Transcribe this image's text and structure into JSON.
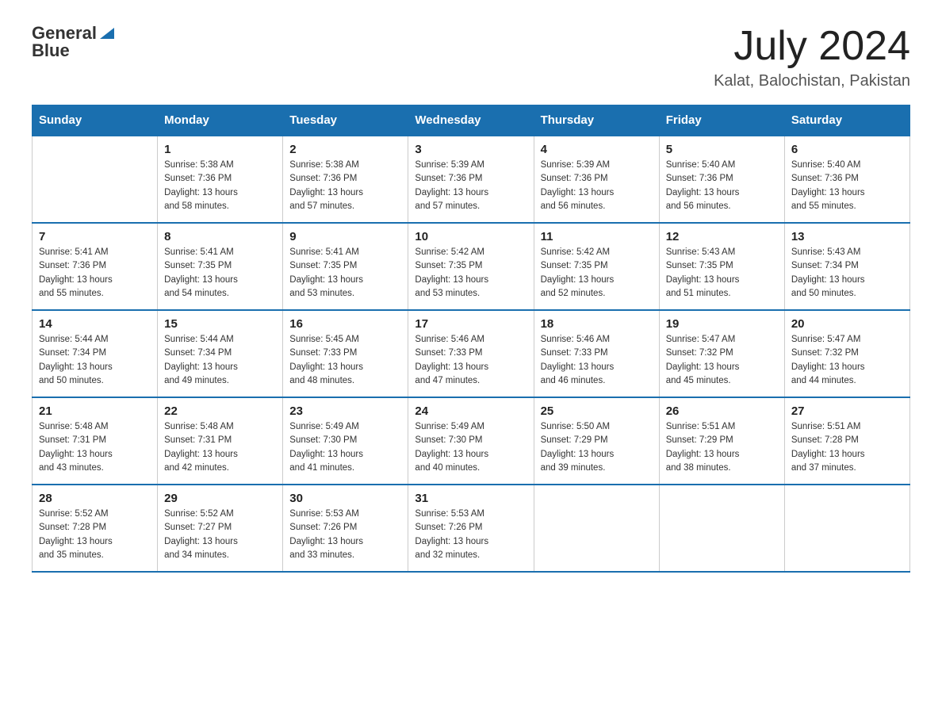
{
  "header": {
    "logo_general": "General",
    "logo_blue": "Blue",
    "month_title": "July 2024",
    "location": "Kalat, Balochistan, Pakistan"
  },
  "days_of_week": [
    "Sunday",
    "Monday",
    "Tuesday",
    "Wednesday",
    "Thursday",
    "Friday",
    "Saturday"
  ],
  "weeks": [
    [
      {
        "day": "",
        "info": ""
      },
      {
        "day": "1",
        "info": "Sunrise: 5:38 AM\nSunset: 7:36 PM\nDaylight: 13 hours\nand 58 minutes."
      },
      {
        "day": "2",
        "info": "Sunrise: 5:38 AM\nSunset: 7:36 PM\nDaylight: 13 hours\nand 57 minutes."
      },
      {
        "day": "3",
        "info": "Sunrise: 5:39 AM\nSunset: 7:36 PM\nDaylight: 13 hours\nand 57 minutes."
      },
      {
        "day": "4",
        "info": "Sunrise: 5:39 AM\nSunset: 7:36 PM\nDaylight: 13 hours\nand 56 minutes."
      },
      {
        "day": "5",
        "info": "Sunrise: 5:40 AM\nSunset: 7:36 PM\nDaylight: 13 hours\nand 56 minutes."
      },
      {
        "day": "6",
        "info": "Sunrise: 5:40 AM\nSunset: 7:36 PM\nDaylight: 13 hours\nand 55 minutes."
      }
    ],
    [
      {
        "day": "7",
        "info": "Sunrise: 5:41 AM\nSunset: 7:36 PM\nDaylight: 13 hours\nand 55 minutes."
      },
      {
        "day": "8",
        "info": "Sunrise: 5:41 AM\nSunset: 7:35 PM\nDaylight: 13 hours\nand 54 minutes."
      },
      {
        "day": "9",
        "info": "Sunrise: 5:41 AM\nSunset: 7:35 PM\nDaylight: 13 hours\nand 53 minutes."
      },
      {
        "day": "10",
        "info": "Sunrise: 5:42 AM\nSunset: 7:35 PM\nDaylight: 13 hours\nand 53 minutes."
      },
      {
        "day": "11",
        "info": "Sunrise: 5:42 AM\nSunset: 7:35 PM\nDaylight: 13 hours\nand 52 minutes."
      },
      {
        "day": "12",
        "info": "Sunrise: 5:43 AM\nSunset: 7:35 PM\nDaylight: 13 hours\nand 51 minutes."
      },
      {
        "day": "13",
        "info": "Sunrise: 5:43 AM\nSunset: 7:34 PM\nDaylight: 13 hours\nand 50 minutes."
      }
    ],
    [
      {
        "day": "14",
        "info": "Sunrise: 5:44 AM\nSunset: 7:34 PM\nDaylight: 13 hours\nand 50 minutes."
      },
      {
        "day": "15",
        "info": "Sunrise: 5:44 AM\nSunset: 7:34 PM\nDaylight: 13 hours\nand 49 minutes."
      },
      {
        "day": "16",
        "info": "Sunrise: 5:45 AM\nSunset: 7:33 PM\nDaylight: 13 hours\nand 48 minutes."
      },
      {
        "day": "17",
        "info": "Sunrise: 5:46 AM\nSunset: 7:33 PM\nDaylight: 13 hours\nand 47 minutes."
      },
      {
        "day": "18",
        "info": "Sunrise: 5:46 AM\nSunset: 7:33 PM\nDaylight: 13 hours\nand 46 minutes."
      },
      {
        "day": "19",
        "info": "Sunrise: 5:47 AM\nSunset: 7:32 PM\nDaylight: 13 hours\nand 45 minutes."
      },
      {
        "day": "20",
        "info": "Sunrise: 5:47 AM\nSunset: 7:32 PM\nDaylight: 13 hours\nand 44 minutes."
      }
    ],
    [
      {
        "day": "21",
        "info": "Sunrise: 5:48 AM\nSunset: 7:31 PM\nDaylight: 13 hours\nand 43 minutes."
      },
      {
        "day": "22",
        "info": "Sunrise: 5:48 AM\nSunset: 7:31 PM\nDaylight: 13 hours\nand 42 minutes."
      },
      {
        "day": "23",
        "info": "Sunrise: 5:49 AM\nSunset: 7:30 PM\nDaylight: 13 hours\nand 41 minutes."
      },
      {
        "day": "24",
        "info": "Sunrise: 5:49 AM\nSunset: 7:30 PM\nDaylight: 13 hours\nand 40 minutes."
      },
      {
        "day": "25",
        "info": "Sunrise: 5:50 AM\nSunset: 7:29 PM\nDaylight: 13 hours\nand 39 minutes."
      },
      {
        "day": "26",
        "info": "Sunrise: 5:51 AM\nSunset: 7:29 PM\nDaylight: 13 hours\nand 38 minutes."
      },
      {
        "day": "27",
        "info": "Sunrise: 5:51 AM\nSunset: 7:28 PM\nDaylight: 13 hours\nand 37 minutes."
      }
    ],
    [
      {
        "day": "28",
        "info": "Sunrise: 5:52 AM\nSunset: 7:28 PM\nDaylight: 13 hours\nand 35 minutes."
      },
      {
        "day": "29",
        "info": "Sunrise: 5:52 AM\nSunset: 7:27 PM\nDaylight: 13 hours\nand 34 minutes."
      },
      {
        "day": "30",
        "info": "Sunrise: 5:53 AM\nSunset: 7:26 PM\nDaylight: 13 hours\nand 33 minutes."
      },
      {
        "day": "31",
        "info": "Sunrise: 5:53 AM\nSunset: 7:26 PM\nDaylight: 13 hours\nand 32 minutes."
      },
      {
        "day": "",
        "info": ""
      },
      {
        "day": "",
        "info": ""
      },
      {
        "day": "",
        "info": ""
      }
    ]
  ]
}
